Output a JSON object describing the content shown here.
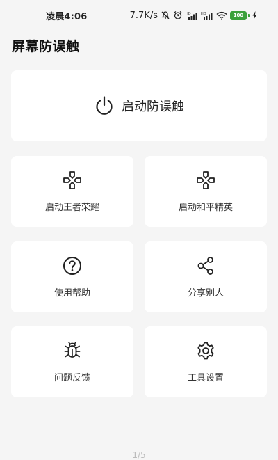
{
  "status_bar": {
    "time": "凌晨4:06",
    "network_speed": "7.7K/s",
    "battery_level": "100"
  },
  "header": {
    "title": "屏幕防误触"
  },
  "main_action": {
    "label": "启动防误触",
    "icon": "power-icon"
  },
  "grid": [
    {
      "label": "启动王者荣耀",
      "icon": "gamepad-icon"
    },
    {
      "label": "启动和平精英",
      "icon": "gamepad-icon"
    },
    {
      "label": "使用帮助",
      "icon": "help-icon"
    },
    {
      "label": "分享别人",
      "icon": "share-icon"
    },
    {
      "label": "问题反馈",
      "icon": "bug-icon"
    },
    {
      "label": "工具设置",
      "icon": "gear-icon"
    }
  ],
  "pager": {
    "indicator": "1/5"
  },
  "colors": {
    "background": "#f5f5f5",
    "card": "#ffffff",
    "battery": "#3ba13b"
  }
}
